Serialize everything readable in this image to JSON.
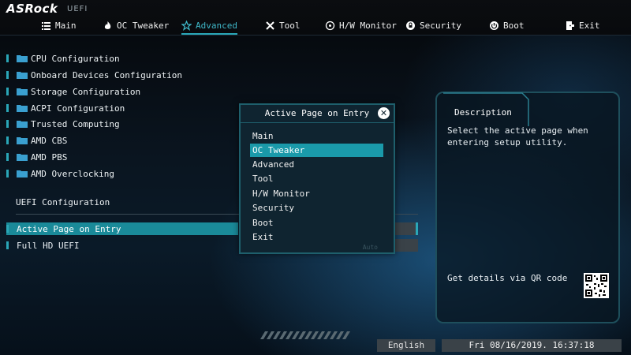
{
  "brand": {
    "name": "ASRock",
    "sub": "UEFI"
  },
  "tabs": [
    {
      "label": "Main",
      "icon": "list-icon"
    },
    {
      "label": "OC Tweaker",
      "icon": "flame-icon"
    },
    {
      "label": "Advanced",
      "icon": "star-icon",
      "active": true
    },
    {
      "label": "Tool",
      "icon": "tools-icon"
    },
    {
      "label": "H/W Monitor",
      "icon": "monitor-icon"
    },
    {
      "label": "Security",
      "icon": "shield-icon"
    },
    {
      "label": "Boot",
      "icon": "power-icon"
    },
    {
      "label": "Exit",
      "icon": "exit-icon"
    }
  ],
  "menu": [
    "CPU Configuration",
    "Onboard Devices Configuration",
    "Storage Configuration",
    "ACPI Configuration",
    "Trusted Computing",
    "AMD CBS",
    "AMD PBS",
    "AMD Overclocking"
  ],
  "section": {
    "label": "UEFI Configuration"
  },
  "options": [
    {
      "label": "Active Page on Entry",
      "selected": true
    },
    {
      "label": "Full HD UEFI",
      "selected": false
    }
  ],
  "popup": {
    "title": "Active Page on Entry",
    "options": [
      "Main",
      "OC Tweaker",
      "Advanced",
      "Tool",
      "H/W Monitor",
      "Security",
      "Boot",
      "Exit"
    ],
    "highlighted": "OC Tweaker",
    "ghost": "Auto"
  },
  "description": {
    "title": "Description",
    "text": "Select the active page when entering setup utility.",
    "qr_text": "Get details via QR code"
  },
  "footer": {
    "language": "English",
    "datetime": "Fri 08/16/2019. 16:37:18"
  },
  "colors": {
    "accent": "#2aa7b8",
    "highlight": "#1a9aaa",
    "panel_border": "#1e4f5c"
  }
}
